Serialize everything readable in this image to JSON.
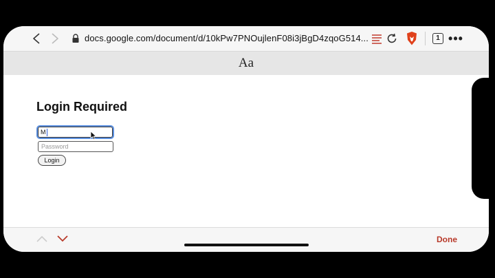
{
  "browser": {
    "url": "docs.google.com/document/d/10kPw7PNOujlenF08i3jBgD4zqoG514...",
    "tab_count": "1",
    "more_label": "•••"
  },
  "font_bar": {
    "label": "Aa"
  },
  "page": {
    "title": "Login Required",
    "username_value": "M",
    "password_placeholder": "Password",
    "login_label": "Login"
  },
  "bottom_bar": {
    "done_label": "Done"
  },
  "colors": {
    "accent": "#b83a2a",
    "focus": "#5a8fe0",
    "brave": "#e0411b"
  }
}
